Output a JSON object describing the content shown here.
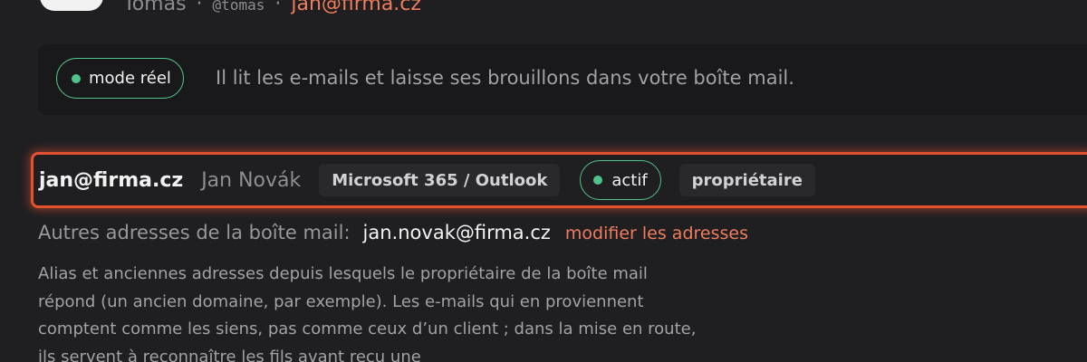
{
  "user": {
    "name": "Tomas",
    "handle": "@tomas",
    "email": "jan@firma.cz",
    "separator": "·"
  },
  "mode": {
    "pill_label": "mode réel",
    "description": "Il lit les e-mails et laisse ses brouillons dans votre boîte mail.",
    "accent_color": "#4fc38a"
  },
  "account": {
    "email": "jan@firma.cz",
    "name": "Jan Novák",
    "provider": "Microsoft 365 / Outlook",
    "status": "actif",
    "role": "propriétaire",
    "highlight_color": "#e4512d"
  },
  "other_addresses": {
    "label": "Autres adresses de la boîte mail:",
    "value": "jan.novak@firma.cz",
    "edit_link": "modifier les adresses",
    "help_text": "Alias et anciennes adresses depuis lesquels le propriétaire de la boîte mail répond (un ancien domaine, par exemple). Les e-mails qui en proviennent comptent comme les siens, pas comme ceux d’un client ; dans la mise en route, ils servent à reconnaître les fils avant reçu une"
  },
  "colors": {
    "background": "#1f1f22",
    "panel": "#19191b",
    "link": "#ef7d5c",
    "status_green": "#4fc38a"
  }
}
